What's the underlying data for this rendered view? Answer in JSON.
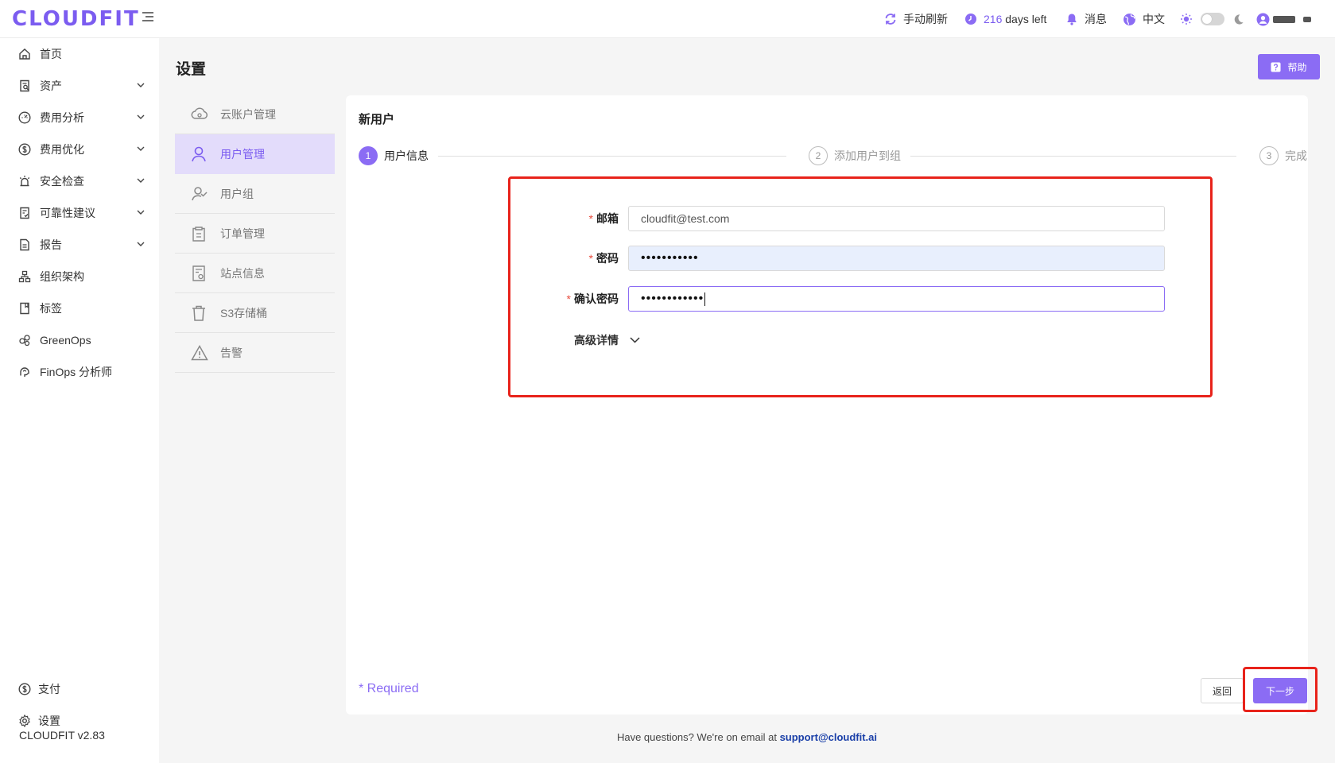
{
  "header": {
    "logo": "CLOUDFIT",
    "refresh_label": "手动刷新",
    "days_count": "216",
    "days_suffix": "days left",
    "messages_label": "消息",
    "language_label": "中文"
  },
  "sidebar": {
    "items": [
      {
        "label": "首页",
        "icon": "home-icon",
        "has_children": false
      },
      {
        "label": "资产",
        "icon": "asset-icon",
        "has_children": true
      },
      {
        "label": "费用分析",
        "icon": "gauge-icon",
        "has_children": true
      },
      {
        "label": "费用优化",
        "icon": "dollar-icon",
        "has_children": true
      },
      {
        "label": "安全检查",
        "icon": "alarm-icon",
        "has_children": true
      },
      {
        "label": "可靠性建议",
        "icon": "checklist-icon",
        "has_children": true
      },
      {
        "label": "报告",
        "icon": "report-icon",
        "has_children": true
      },
      {
        "label": "组织架构",
        "icon": "org-icon",
        "has_children": false
      },
      {
        "label": "标签",
        "icon": "tag-icon",
        "has_children": false
      },
      {
        "label": "GreenOps",
        "icon": "leaf-icon",
        "has_children": false
      },
      {
        "label": "FinOps 分析师",
        "icon": "analyst-icon",
        "has_children": false
      }
    ],
    "bottom": [
      {
        "label": "支付",
        "icon": "payment-icon"
      },
      {
        "label": "设置",
        "icon": "gear-icon"
      }
    ],
    "version": "CLOUDFIT v2.83"
  },
  "page": {
    "title": "设置",
    "help_label": "帮助"
  },
  "settings_nav": {
    "items": [
      {
        "label": "云账户管理",
        "icon": "cloud-icon",
        "active": false
      },
      {
        "label": "用户管理",
        "icon": "user-icon",
        "active": true
      },
      {
        "label": "用户组",
        "icon": "user-group-icon",
        "active": false
      },
      {
        "label": "订单管理",
        "icon": "order-icon",
        "active": false
      },
      {
        "label": "站点信息",
        "icon": "site-icon",
        "active": false
      },
      {
        "label": "S3存储桶",
        "icon": "bucket-icon",
        "active": false
      },
      {
        "label": "告警",
        "icon": "warning-icon",
        "active": false
      }
    ]
  },
  "form": {
    "title": "新用户",
    "steps": [
      {
        "number": "1",
        "label": "用户信息",
        "state": "current"
      },
      {
        "number": "2",
        "label": "添加用户到组",
        "state": "todo"
      },
      {
        "number": "3",
        "label": "完成",
        "state": "todo"
      }
    ],
    "email": {
      "label": "邮箱",
      "value": "cloudfit@test.com"
    },
    "password": {
      "label": "密码",
      "value": "•••••••••••"
    },
    "confirm_password": {
      "label": "确认密码",
      "value": "••••••••••••"
    },
    "advanced_label": "高级详情",
    "required_note": "* Required",
    "back_label": "返回",
    "next_label": "下一步"
  },
  "footer": {
    "text": "Have questions? We're on email at",
    "email": "support@cloudfit.ai"
  },
  "colors": {
    "accent": "#8b6cf4",
    "highlight_box": "#e8231b"
  }
}
